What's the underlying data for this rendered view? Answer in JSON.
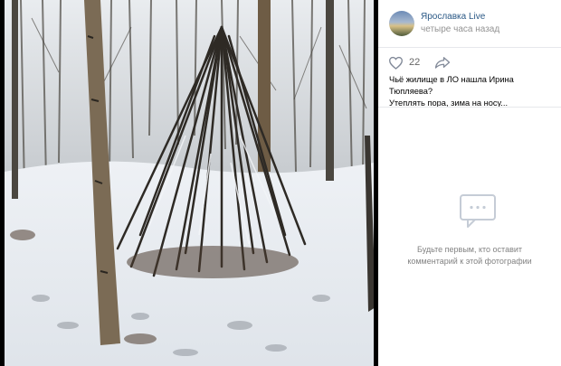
{
  "post": {
    "author": "Ярославка Live",
    "time": "четыре часа назад",
    "likes": "22",
    "caption_line1": "Чьё жилище в ЛО нашла Ирина Тюпляева?",
    "caption_line2": "Утеплять пора, зима на носу..."
  },
  "comments": {
    "empty_line1": "Будьте первым, кто оставит",
    "empty_line2": "комментарий к этой фотографии"
  },
  "icons": {
    "like": "heart-icon",
    "share": "share-arrow-icon",
    "comments": "speech-bubble-icon"
  },
  "colors": {
    "author_link": "#2a5885",
    "muted_text": "#939393",
    "icon_gray": "#828a99",
    "divider": "#e7e8ec"
  }
}
